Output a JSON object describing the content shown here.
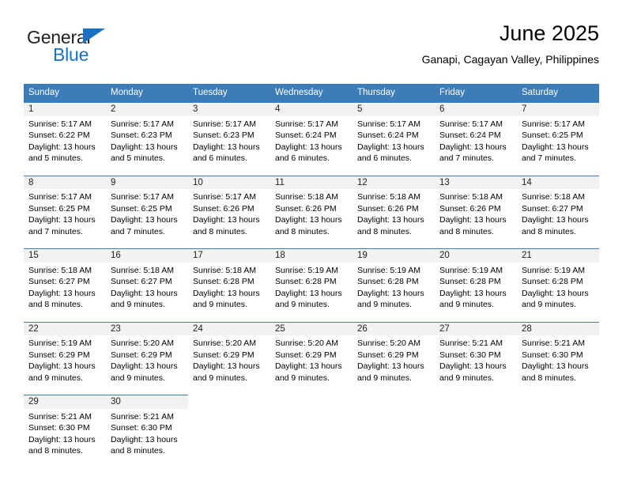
{
  "brand": {
    "name_part1": "General",
    "name_part2": "Blue",
    "accent_color": "#1a71c4",
    "triangle_icon": "triangle-icon"
  },
  "header": {
    "title": "June 2025",
    "subtitle": "Ganapi, Cagayan Valley, Philippines"
  },
  "theme": {
    "header_bg": "#3c7cb8",
    "daynum_bg": "#f2f2f2",
    "cell_bg": "#ffffff",
    "separator": "#3c7cb8"
  },
  "calendar": {
    "weekday_headers": [
      "Sunday",
      "Monday",
      "Tuesday",
      "Wednesday",
      "Thursday",
      "Friday",
      "Saturday"
    ],
    "weeks": [
      {
        "days": [
          {
            "num": "1",
            "sunrise": "Sunrise: 5:17 AM",
            "sunset": "Sunset: 6:22 PM",
            "daylight1": "Daylight: 13 hours",
            "daylight2": "and 5 minutes."
          },
          {
            "num": "2",
            "sunrise": "Sunrise: 5:17 AM",
            "sunset": "Sunset: 6:23 PM",
            "daylight1": "Daylight: 13 hours",
            "daylight2": "and 5 minutes."
          },
          {
            "num": "3",
            "sunrise": "Sunrise: 5:17 AM",
            "sunset": "Sunset: 6:23 PM",
            "daylight1": "Daylight: 13 hours",
            "daylight2": "and 6 minutes."
          },
          {
            "num": "4",
            "sunrise": "Sunrise: 5:17 AM",
            "sunset": "Sunset: 6:24 PM",
            "daylight1": "Daylight: 13 hours",
            "daylight2": "and 6 minutes."
          },
          {
            "num": "5",
            "sunrise": "Sunrise: 5:17 AM",
            "sunset": "Sunset: 6:24 PM",
            "daylight1": "Daylight: 13 hours",
            "daylight2": "and 6 minutes."
          },
          {
            "num": "6",
            "sunrise": "Sunrise: 5:17 AM",
            "sunset": "Sunset: 6:24 PM",
            "daylight1": "Daylight: 13 hours",
            "daylight2": "and 7 minutes."
          },
          {
            "num": "7",
            "sunrise": "Sunrise: 5:17 AM",
            "sunset": "Sunset: 6:25 PM",
            "daylight1": "Daylight: 13 hours",
            "daylight2": "and 7 minutes."
          }
        ]
      },
      {
        "days": [
          {
            "num": "8",
            "sunrise": "Sunrise: 5:17 AM",
            "sunset": "Sunset: 6:25 PM",
            "daylight1": "Daylight: 13 hours",
            "daylight2": "and 7 minutes."
          },
          {
            "num": "9",
            "sunrise": "Sunrise: 5:17 AM",
            "sunset": "Sunset: 6:25 PM",
            "daylight1": "Daylight: 13 hours",
            "daylight2": "and 7 minutes."
          },
          {
            "num": "10",
            "sunrise": "Sunrise: 5:17 AM",
            "sunset": "Sunset: 6:26 PM",
            "daylight1": "Daylight: 13 hours",
            "daylight2": "and 8 minutes."
          },
          {
            "num": "11",
            "sunrise": "Sunrise: 5:18 AM",
            "sunset": "Sunset: 6:26 PM",
            "daylight1": "Daylight: 13 hours",
            "daylight2": "and 8 minutes."
          },
          {
            "num": "12",
            "sunrise": "Sunrise: 5:18 AM",
            "sunset": "Sunset: 6:26 PM",
            "daylight1": "Daylight: 13 hours",
            "daylight2": "and 8 minutes."
          },
          {
            "num": "13",
            "sunrise": "Sunrise: 5:18 AM",
            "sunset": "Sunset: 6:26 PM",
            "daylight1": "Daylight: 13 hours",
            "daylight2": "and 8 minutes."
          },
          {
            "num": "14",
            "sunrise": "Sunrise: 5:18 AM",
            "sunset": "Sunset: 6:27 PM",
            "daylight1": "Daylight: 13 hours",
            "daylight2": "and 8 minutes."
          }
        ]
      },
      {
        "days": [
          {
            "num": "15",
            "sunrise": "Sunrise: 5:18 AM",
            "sunset": "Sunset: 6:27 PM",
            "daylight1": "Daylight: 13 hours",
            "daylight2": "and 8 minutes."
          },
          {
            "num": "16",
            "sunrise": "Sunrise: 5:18 AM",
            "sunset": "Sunset: 6:27 PM",
            "daylight1": "Daylight: 13 hours",
            "daylight2": "and 9 minutes."
          },
          {
            "num": "17",
            "sunrise": "Sunrise: 5:18 AM",
            "sunset": "Sunset: 6:28 PM",
            "daylight1": "Daylight: 13 hours",
            "daylight2": "and 9 minutes."
          },
          {
            "num": "18",
            "sunrise": "Sunrise: 5:19 AM",
            "sunset": "Sunset: 6:28 PM",
            "daylight1": "Daylight: 13 hours",
            "daylight2": "and 9 minutes."
          },
          {
            "num": "19",
            "sunrise": "Sunrise: 5:19 AM",
            "sunset": "Sunset: 6:28 PM",
            "daylight1": "Daylight: 13 hours",
            "daylight2": "and 9 minutes."
          },
          {
            "num": "20",
            "sunrise": "Sunrise: 5:19 AM",
            "sunset": "Sunset: 6:28 PM",
            "daylight1": "Daylight: 13 hours",
            "daylight2": "and 9 minutes."
          },
          {
            "num": "21",
            "sunrise": "Sunrise: 5:19 AM",
            "sunset": "Sunset: 6:28 PM",
            "daylight1": "Daylight: 13 hours",
            "daylight2": "and 9 minutes."
          }
        ]
      },
      {
        "days": [
          {
            "num": "22",
            "sunrise": "Sunrise: 5:19 AM",
            "sunset": "Sunset: 6:29 PM",
            "daylight1": "Daylight: 13 hours",
            "daylight2": "and 9 minutes."
          },
          {
            "num": "23",
            "sunrise": "Sunrise: 5:20 AM",
            "sunset": "Sunset: 6:29 PM",
            "daylight1": "Daylight: 13 hours",
            "daylight2": "and 9 minutes."
          },
          {
            "num": "24",
            "sunrise": "Sunrise: 5:20 AM",
            "sunset": "Sunset: 6:29 PM",
            "daylight1": "Daylight: 13 hours",
            "daylight2": "and 9 minutes."
          },
          {
            "num": "25",
            "sunrise": "Sunrise: 5:20 AM",
            "sunset": "Sunset: 6:29 PM",
            "daylight1": "Daylight: 13 hours",
            "daylight2": "and 9 minutes."
          },
          {
            "num": "26",
            "sunrise": "Sunrise: 5:20 AM",
            "sunset": "Sunset: 6:29 PM",
            "daylight1": "Daylight: 13 hours",
            "daylight2": "and 9 minutes."
          },
          {
            "num": "27",
            "sunrise": "Sunrise: 5:21 AM",
            "sunset": "Sunset: 6:30 PM",
            "daylight1": "Daylight: 13 hours",
            "daylight2": "and 9 minutes."
          },
          {
            "num": "28",
            "sunrise": "Sunrise: 5:21 AM",
            "sunset": "Sunset: 6:30 PM",
            "daylight1": "Daylight: 13 hours",
            "daylight2": "and 8 minutes."
          }
        ]
      },
      {
        "days": [
          {
            "num": "29",
            "sunrise": "Sunrise: 5:21 AM",
            "sunset": "Sunset: 6:30 PM",
            "daylight1": "Daylight: 13 hours",
            "daylight2": "and 8 minutes."
          },
          {
            "num": "30",
            "sunrise": "Sunrise: 5:21 AM",
            "sunset": "Sunset: 6:30 PM",
            "daylight1": "Daylight: 13 hours",
            "daylight2": "and 8 minutes."
          },
          {
            "num": "",
            "sunrise": "",
            "sunset": "",
            "daylight1": "",
            "daylight2": ""
          },
          {
            "num": "",
            "sunrise": "",
            "sunset": "",
            "daylight1": "",
            "daylight2": ""
          },
          {
            "num": "",
            "sunrise": "",
            "sunset": "",
            "daylight1": "",
            "daylight2": ""
          },
          {
            "num": "",
            "sunrise": "",
            "sunset": "",
            "daylight1": "",
            "daylight2": ""
          },
          {
            "num": "",
            "sunrise": "",
            "sunset": "",
            "daylight1": "",
            "daylight2": ""
          }
        ]
      }
    ]
  }
}
